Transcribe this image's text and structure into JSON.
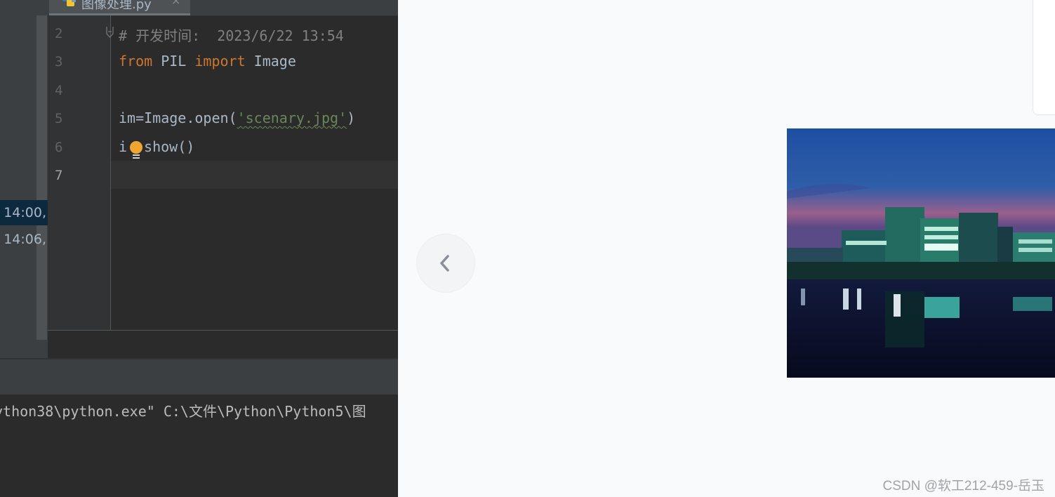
{
  "editor": {
    "tab": {
      "label": "图像处理.py",
      "close_glyph": "×"
    },
    "vcs_annotations": [
      {
        "label": "2 14:00,"
      },
      {
        "label": "14:06,"
      }
    ],
    "line_numbers": [
      "2",
      "3",
      "4",
      "5",
      "6",
      "7"
    ],
    "current_line": "7",
    "code": {
      "line2": "# 开发时间:  2023/6/22 13:54",
      "line3": {
        "kw1": "from",
        "mod": " PIL ",
        "kw2": "import",
        "name": " Image"
      },
      "line5": {
        "pre": "im=Image.open(",
        "str": "'scenary.jpg'",
        "post": ")"
      },
      "line6": {
        "pre": "i",
        "post": "show()"
      }
    },
    "console": {
      "line1": "ython38\\python.exe\" C:\\文件\\Python\\Python5\\图"
    }
  },
  "viewer": {
    "prev_label": "<",
    "watermark": "CSDN @软工212-459-岳玉"
  },
  "colors": {
    "keyword": "#cc7832",
    "string": "#6a8759",
    "comment": "#808080",
    "editor_bg": "#2b2b2b",
    "viewer_bg": "#f9fafc"
  },
  "icons": {
    "tab": "python-file-icon",
    "bulb": "intention-bulb-icon",
    "prev": "chevron-left-icon"
  }
}
